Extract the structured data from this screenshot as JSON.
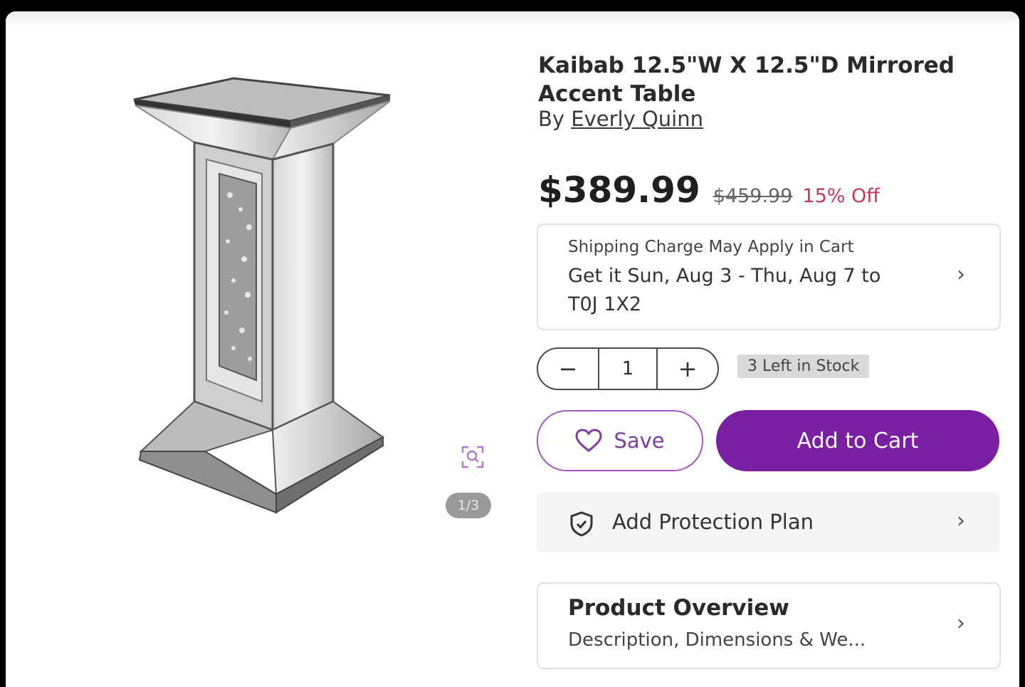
{
  "product": {
    "title": "Kaibab 12.5\"W X 12.5\"D Mirrored Accent Table",
    "brand_prefix": "By",
    "brand": "Everly Quinn",
    "image_icon": "mirrored-pedestal-table-image"
  },
  "gallery": {
    "counter": "1/3",
    "zoom_icon": "zoom-icon"
  },
  "pricing": {
    "price": "$389.99",
    "was_price": "$459.99",
    "discount": "15% Off",
    "discount_color": "#c4385f"
  },
  "shipping": {
    "note": "Shipping Charge May Apply in Cart",
    "delivery": "Get it Sun, Aug 3 - Thu, Aug 7 to T0J 1X2",
    "chevron_icon": "chevron-right-icon"
  },
  "quantity": {
    "minus": "−",
    "value": "1",
    "plus": "+",
    "stock_badge": "3 Left in Stock"
  },
  "actions": {
    "save_label": "Save",
    "save_icon": "heart-icon",
    "cart_label": "Add to Cart",
    "cart_color": "#7b1fa2"
  },
  "protection": {
    "label": "Add Protection Plan",
    "icon": "shield-check-icon"
  },
  "overview": {
    "heading": "Product Overview",
    "subtext": "Description, Dimensions & We..."
  }
}
